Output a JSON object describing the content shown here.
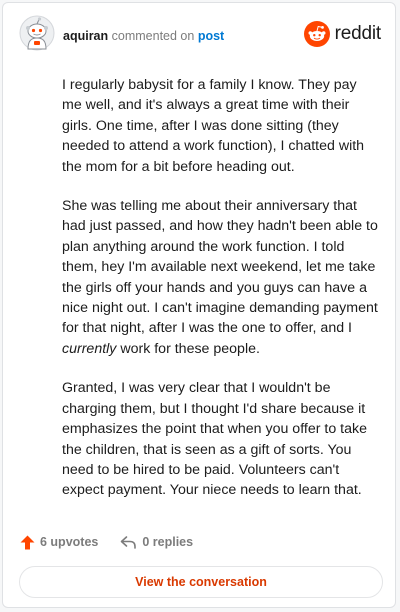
{
  "header": {
    "username": "aquiran",
    "action_text": "commented on",
    "post_link": "post",
    "logo_text": "reddit",
    "brand_color": "#ff4500",
    "link_color": "#0079d3"
  },
  "comment": {
    "paragraphs": [
      {
        "before": "I regularly babysit for a family I know. They pay me well, and it's always a great time with their girls. One time, after I was done sitting (they needed to attend a work function), I chatted with the mom for a bit before heading out.",
        "emphasis": "",
        "after": ""
      },
      {
        "before": "She was telling me about their anniversary that had just passed, and how they hadn't been able to plan anything around the work function. I told them, hey I'm available next weekend, let me take the girls off your hands and you guys can have a nice night out. I can't imagine demanding payment for that night, after I was the one to offer, and I ",
        "emphasis": "currently",
        "after": " work for these people."
      },
      {
        "before": "Granted, I was very clear that I wouldn't be charging them, but I thought I'd share because it emphasizes the point that when you offer to take the children, that is seen as a gift of sorts. You need to be hired to be paid. Volunteers can't expect payment. Your niece needs to learn that.",
        "emphasis": "",
        "after": ""
      }
    ]
  },
  "footer": {
    "upvotes_label": "6 upvotes",
    "replies_label": "0 replies",
    "upvote_icon": "upvote-arrow-icon",
    "reply_icon": "reply-arrow-icon",
    "upvote_color": "#ff4500"
  },
  "cta": {
    "label": "View the conversation",
    "color": "#d93900"
  }
}
